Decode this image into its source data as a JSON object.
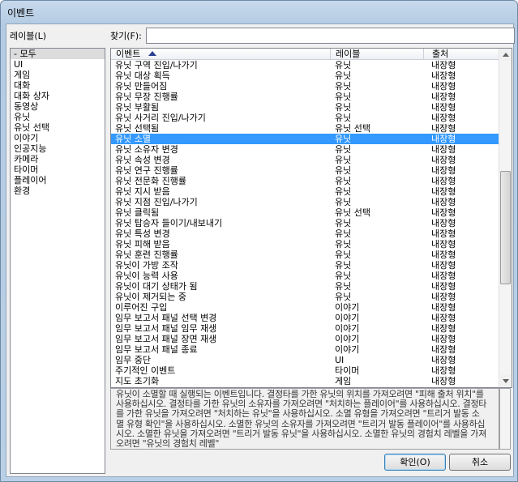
{
  "window": {
    "title": "이벤트"
  },
  "left": {
    "label": "레이블(L)",
    "items": [
      "- 모두",
      "UI",
      "게임",
      "대화",
      "대화 상자",
      "동영상",
      "유닛",
      "유닛 선택",
      "이야기",
      "인공지능",
      "카메라",
      "타이머",
      "플레이어",
      "환경"
    ],
    "selected_index": 0
  },
  "search": {
    "label": "찾기(F):",
    "value": ""
  },
  "grid": {
    "columns": [
      "이벤트",
      "레이블",
      "출처"
    ],
    "sort_column": "이벤트",
    "selected_index": 7,
    "rows": [
      [
        "유닛 구역 진입/나가기",
        "유닛",
        "내장형"
      ],
      [
        "유닛 대상 획득",
        "유닛",
        "내장형"
      ],
      [
        "유닛 만들어짐",
        "유닛",
        "내장형"
      ],
      [
        "유닛 무장 진행률",
        "유닛",
        "내장형"
      ],
      [
        "유닛 부활됨",
        "유닛",
        "내장형"
      ],
      [
        "유닛 사거리 진입/나가기",
        "유닛",
        "내장형"
      ],
      [
        "유닛 선택됨",
        "유닛 선택",
        "내장형"
      ],
      [
        "유닛 소멸",
        "유닛",
        "내장형"
      ],
      [
        "유닛 소유자 변경",
        "유닛",
        "내장형"
      ],
      [
        "유닛 속성 변경",
        "유닛",
        "내장형"
      ],
      [
        "유닛 연구 진행률",
        "유닛",
        "내장형"
      ],
      [
        "유닛 전문화 진행률",
        "유닛",
        "내장형"
      ],
      [
        "유닛 지시 받음",
        "유닛",
        "내장형"
      ],
      [
        "유닛 지점 진입/나가기",
        "유닛",
        "내장형"
      ],
      [
        "유닛 클릭됨",
        "유닛 선택",
        "내장형"
      ],
      [
        "유닛 탑승자 들이기/내보내기",
        "유닛",
        "내장형"
      ],
      [
        "유닛 특성 변경",
        "유닛",
        "내장형"
      ],
      [
        "유닛 피해 받음",
        "유닛",
        "내장형"
      ],
      [
        "유닛 훈련 진행률",
        "유닛",
        "내장형"
      ],
      [
        "유닛이 가방 조작",
        "유닛",
        "내장형"
      ],
      [
        "유닛이 능력 사용",
        "유닛",
        "내장형"
      ],
      [
        "유닛이 대기 상태가 됨",
        "유닛",
        "내장형"
      ],
      [
        "유닛이 제거되는 중",
        "유닛",
        "내장형"
      ],
      [
        "이루어진 구입",
        "이야기",
        "내장형"
      ],
      [
        "임무 보고서 패널 선택 변경",
        "이야기",
        "내장형"
      ],
      [
        "임무 보고서 패널 임무 재생",
        "이야기",
        "내장형"
      ],
      [
        "임무 보고서 패널 장면 재생",
        "이야기",
        "내장형"
      ],
      [
        "임무 보고서 패널 종료",
        "이야기",
        "내장형"
      ],
      [
        "임무 중단",
        "UI",
        "내장형"
      ],
      [
        "주기적인 이벤트",
        "타이머",
        "내장형"
      ],
      [
        "지도 초기화",
        "게임",
        "내장형"
      ]
    ],
    "scroll_position": 0.55
  },
  "description": "유닛이 소멸할 때 실행되는 이벤트입니다. 결정타를 가한 유닛의 위치를 가져오려면 \"피해 출처 위치\"를 사용하십시오. 결정타를 가한 유닛의 소유자를 가져오려면 \"처치하는 플레이어\"를 사용하십시오. 결정타를 가한 유닛을 가져오려면 \"처치하는 유닛\"을 사용하십시오. 소멸 유형을 가져오려면 \"트리거 발동 소멸 유형 확인\"을 사용하십시오. 소멸한 유닛의 소유자를 가져오려면 \"트리거 발동 플레이어\"를 사용하십시오. 소멸한 유닛을 가져오려면 \"트리거 발동 유닛\"을 사용하십시오. 소멸한 유닛의 경험치 레벨을 가져오려면 \"유닛의 경험치 레벨\"",
  "buttons": {
    "ok": "확인(O)",
    "cancel": "취소"
  }
}
